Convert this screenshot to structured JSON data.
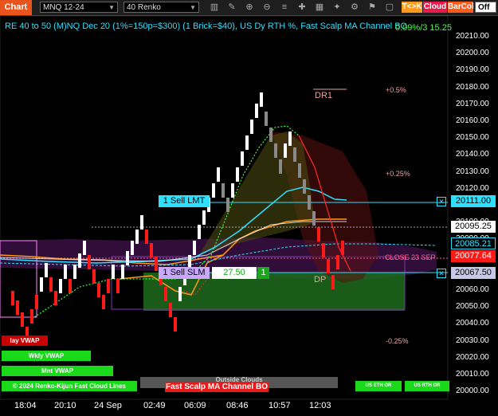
{
  "toolbar": {
    "chart_tab": "Chart",
    "instrument": "MNQ 12-24",
    "bar_type": "40 Renko",
    "tk_button": "T<>K",
    "cloud_button": "Cloud",
    "barcol_button": "BarCol",
    "off_select": "Off"
  },
  "chart": {
    "title": "RE 40 to 50 (M)NQ Dec 20 (1%=150p=$300) (1 Brick=$40), US Dy RTH %, Fast Scalp MA Channel BO",
    "top_right_overlay": "0.09%/3 15.25",
    "dr1_label": "DR1",
    "dp_label": "DP",
    "close_label": "CLOSE 23 SEP",
    "pct_plus_05": "+0.5%",
    "pct_plus_025": "+0.25%",
    "pct_minus_025": "-0.25%",
    "sell_lmt": "1 Sell LMT",
    "sell_slm": "1 Sell SLM",
    "slm_price": "27.50",
    "slm_qty": "1",
    "vwap_chips": [
      "lay VWAP",
      "Wkly VWAP",
      "Mnt VWAP",
      "Renko-Kijun Fast Cloud Lines"
    ],
    "copyright": "© 2024",
    "fast_scalp_chip": "Fast Scalp MA Channel BO",
    "outside_clouds": "Outside Clouds",
    "us_eth_chip": "US ETH OR",
    "us_rth_chip": "US RTH OR"
  },
  "axis": {
    "y_ticks": [
      "20210.00",
      "20200.00",
      "20190.00",
      "20180.00",
      "20170.00",
      "20160.00",
      "20150.00",
      "20140.00",
      "20130.00",
      "20120.00",
      "20110.00",
      "20100.00",
      "20090.00",
      "20080.00",
      "20070.00",
      "20060.00",
      "20050.00",
      "20040.00",
      "20030.00",
      "20020.00",
      "20010.00",
      "20000.00"
    ],
    "x_ticks": [
      "18:04",
      "20:10",
      "24 Sep",
      "02:49",
      "06:09",
      "08:46",
      "10:57",
      "12:03"
    ],
    "price_tags": [
      {
        "value": "20111.00",
        "kind": "cyan"
      },
      {
        "value": "20095.25",
        "kind": "white"
      },
      {
        "value": "20085.21",
        "kind": "teal"
      },
      {
        "value": "20077.64",
        "kind": "red"
      },
      {
        "value": "20067.50",
        "kind": "slate"
      }
    ]
  },
  "colors": {
    "up_brick": "#ffffff",
    "down_brick": "#ff1a1a",
    "fade_up": "#8a8a8a",
    "cyan": "#2ee0ff",
    "orange": "#ff9a1a",
    "purple": "#8a2a8a",
    "green_cloud": "#1e6b1e"
  }
}
